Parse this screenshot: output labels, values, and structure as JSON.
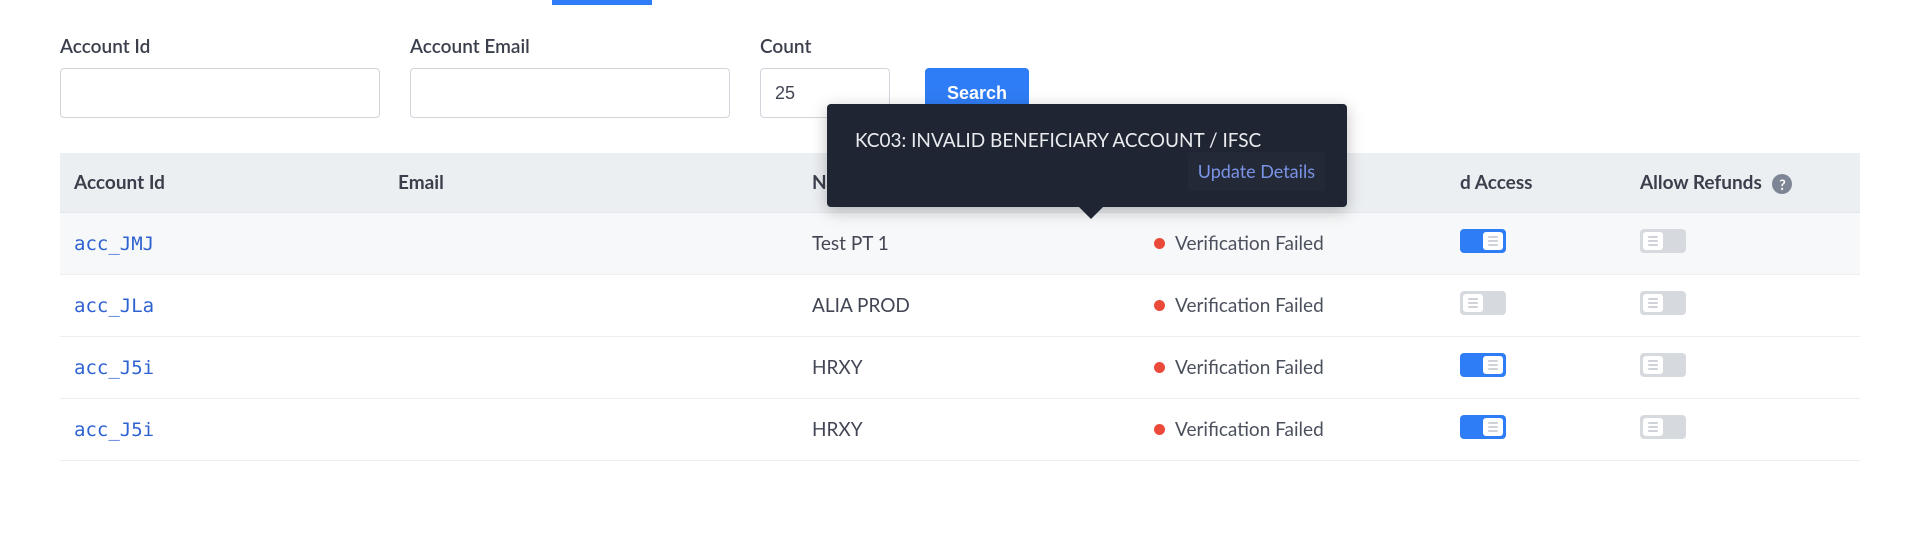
{
  "filters": {
    "account_id_label": "Account Id",
    "account_id_value": "",
    "account_email_label": "Account Email",
    "account_email_value": "",
    "count_label": "Count",
    "count_value": "25",
    "search_label": "Search"
  },
  "table": {
    "headers": {
      "account_id": "Account Id",
      "email": "Email",
      "name": "Name",
      "dashboard_access_suffix": "d Access",
      "allow_refunds": "Allow Refunds"
    },
    "rows": [
      {
        "account_id": "acc_JMJ",
        "email": "",
        "name": "Test PT 1",
        "status_text": "Verification Failed",
        "status_color": "#eb4a3a",
        "dashboard_access": true,
        "allow_refunds": false
      },
      {
        "account_id": "acc_JLa",
        "email": "",
        "name": "ALIA PROD",
        "status_text": "Verification Failed",
        "status_color": "#eb4a3a",
        "dashboard_access": false,
        "allow_refunds": false
      },
      {
        "account_id": "acc_J5i",
        "email": "",
        "name": "HRXY",
        "status_text": "Verification Failed",
        "status_color": "#eb4a3a",
        "dashboard_access": true,
        "allow_refunds": false
      },
      {
        "account_id": "acc_J5i",
        "email": "",
        "name": "HRXY",
        "status_text": "Verification Failed",
        "status_color": "#eb4a3a",
        "dashboard_access": true,
        "allow_refunds": false
      }
    ]
  },
  "tooltip": {
    "message": "KC03: INVALID BENEFICIARY ACCOUNT / IFSC",
    "action_label": "Update Details"
  }
}
